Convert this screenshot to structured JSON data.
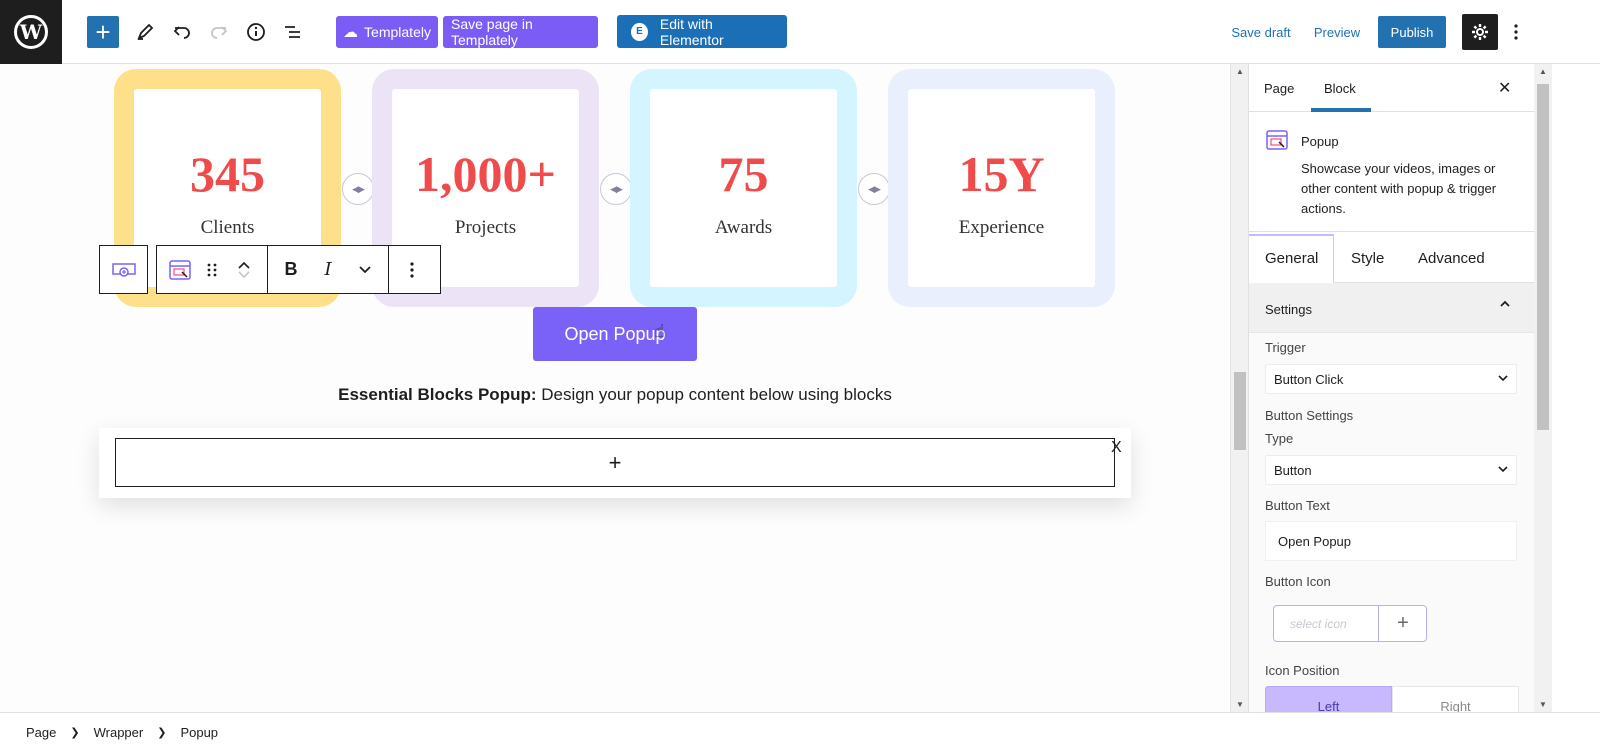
{
  "topbar": {
    "templately_label": "Templately",
    "save_templately_label": "Save page in Templately",
    "elementor_label": "Edit with Elementor",
    "save_draft_label": "Save draft",
    "preview_label": "Preview",
    "publish_label": "Publish"
  },
  "counters": [
    {
      "number": "345",
      "label": "Clients",
      "color": "#ffe08a"
    },
    {
      "number": "1,000+",
      "label": "Projects",
      "color": "#ece3f7"
    },
    {
      "number": "75",
      "label": "Awards",
      "color": "#d4f4ff"
    },
    {
      "number": "15Y",
      "label": "Experience",
      "color": "#e9effd"
    }
  ],
  "canvas": {
    "open_popup_label": "Open Popup",
    "caption_bold": "Essential Blocks Popup:",
    "caption_rest": " Design your popup content below using blocks",
    "popup_add": "+",
    "popup_close": "X"
  },
  "toolbar": {
    "bold": "B",
    "italic": "I"
  },
  "sidebar": {
    "tab_page": "Page",
    "tab_block": "Block",
    "block_title": "Popup",
    "block_desc": "Showcase your videos, images or other content with popup & trigger actions.",
    "subtab_general": "General",
    "subtab_style": "Style",
    "subtab_advanced": "Advanced",
    "panel_title": "Settings",
    "trigger_label": "Trigger",
    "trigger_value": "Button Click",
    "button_settings_label": "Button Settings",
    "type_label": "Type",
    "type_value": "Button",
    "button_text_label": "Button Text",
    "button_text_value": "Open Popup",
    "button_icon_label": "Button Icon",
    "icon_placeholder": "select icon",
    "icon_position_label": "Icon Position",
    "pos_left": "Left",
    "pos_right": "Right"
  },
  "breadcrumb": {
    "items": [
      "Page",
      "Wrapper",
      "Popup"
    ]
  },
  "colors": {
    "accent": "#2271b1",
    "purple": "#7a62f9",
    "number_red": "#f04b4b"
  }
}
